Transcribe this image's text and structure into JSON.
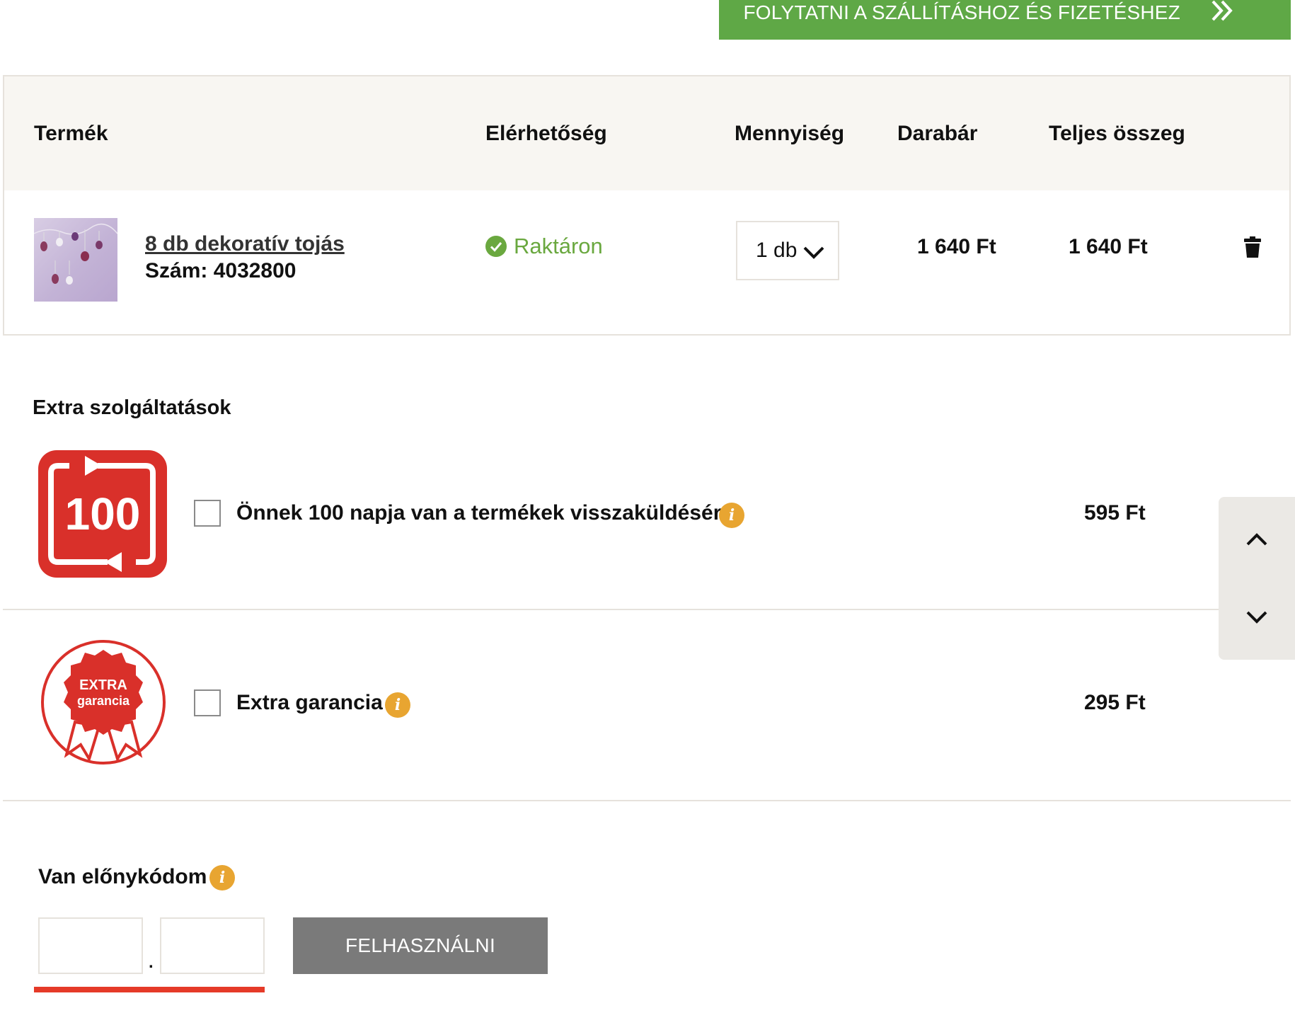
{
  "header": {
    "continue_label": "FOLYTATNI A SZÁLLÍTÁSHOZ ÉS FIZETÉSHEZ"
  },
  "cart": {
    "columns": {
      "product": "Termék",
      "availability": "Elérhetőség",
      "quantity": "Mennyiség",
      "unit_price": "Darabár",
      "total": "Teljes összeg"
    },
    "item": {
      "name": "8 db dekoratív tojás",
      "number": "Szám: 4032800",
      "availability": "Raktáron",
      "quantity": "1 db",
      "unit_price": "1 640 Ft",
      "total": "1 640 Ft"
    }
  },
  "extras": {
    "title": "Extra szolgáltatások",
    "items": [
      {
        "logo_text": "100",
        "label": "Önnek 100 napja van a termékek visszaküldésére",
        "price": "595 Ft",
        "checked": false
      },
      {
        "logo_text_top": "EXTRA",
        "logo_text_bottom": "garancia",
        "label": "Extra garancia",
        "price": "295 Ft",
        "checked": false
      }
    ]
  },
  "promo": {
    "title": "Van előnykódom",
    "separator": ".",
    "field1_value": "",
    "field2_value": "",
    "apply_label": "FELHASZNÁLNI"
  },
  "icons": {
    "info": "info-icon",
    "available": "check-circle-icon",
    "delete": "trash-icon",
    "scroll_up": "chevron-up-icon",
    "scroll_down": "chevron-down-icon"
  },
  "colors": {
    "primary_green": "#5fa846",
    "stock_green": "#6aa83f",
    "info_orange": "#e8a531",
    "brand_red": "#d9302a",
    "button_gray": "#7a7a7a",
    "header_bg": "#f8f6f2"
  }
}
